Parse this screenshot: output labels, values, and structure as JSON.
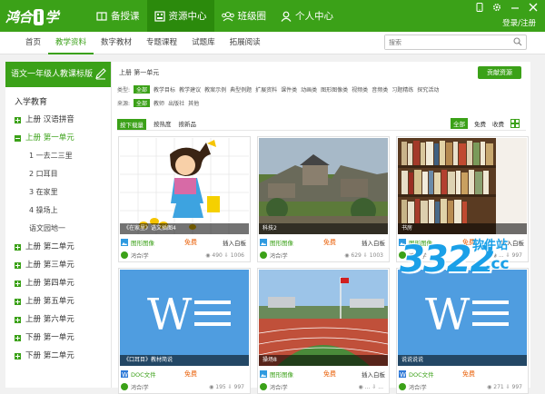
{
  "app": {
    "logo_text_1": "鸿合",
    "logo_text_i": "i",
    "logo_text_2": "学",
    "nav": [
      {
        "label": "备授课",
        "active": false
      },
      {
        "label": "资源中心",
        "active": true
      },
      {
        "label": "班级圈",
        "active": false
      },
      {
        "label": "个人中心",
        "active": false
      }
    ],
    "login_label": "登录/注册"
  },
  "subnav": {
    "tabs": [
      "首页",
      "教学资料",
      "数字教材",
      "专题课程",
      "试题库",
      "拓展阅读"
    ],
    "active_index": 1,
    "search_placeholder": "搜索"
  },
  "sidebar": {
    "title": "语文一年级人教课标版",
    "section": "入学教育",
    "items_before": [
      {
        "label": "上册 汉语拼音",
        "open": false
      }
    ],
    "open_item": {
      "label": "上册 第一单元"
    },
    "sub_items": [
      "1 一去二三里",
      "2 口耳目",
      "3 在家里",
      "4 操场上",
      "语文园地一"
    ],
    "items_after": [
      {
        "label": "上册 第二单元"
      },
      {
        "label": "上册 第三单元"
      },
      {
        "label": "上册 第四单元"
      },
      {
        "label": "上册 第五单元"
      },
      {
        "label": "上册 第六单元"
      },
      {
        "label": "下册 第一单元"
      },
      {
        "label": "下册 第二单元"
      }
    ]
  },
  "panel": {
    "breadcrumb": "上册 第一单元",
    "contribute_label": "贡献资源",
    "filter_type": {
      "label": "类型:",
      "options": [
        "全部",
        "教学目标",
        "教学建议",
        "教案示例",
        "典型例题",
        "扩展资料",
        "课件类",
        "动画类",
        "图形图像类",
        "视频类",
        "音频类",
        "习题精练",
        "探究活动"
      ],
      "active_index": 0
    },
    "filter_source": {
      "label": "来源:",
      "options": [
        "全部",
        "教师",
        "出版社",
        "其他"
      ],
      "active_index": 0
    },
    "sort": {
      "options": [
        "按下载量",
        "按热度",
        "按新品"
      ],
      "active_index": 0
    },
    "price": {
      "options": [
        "全部",
        "免费",
        "收费"
      ],
      "active_index": 0
    }
  },
  "cards": [
    {
      "caption": "《在家里》语文插图4",
      "type": "图形图像",
      "price": "免费",
      "action": "插入白板",
      "author": "鸿合i学",
      "views": "490",
      "downloads": "1006"
    },
    {
      "caption": "科技2",
      "type": "图形图像",
      "price": "免费",
      "action": "插入白板",
      "author": "鸿合i学",
      "views": "629",
      "downloads": "1003"
    },
    {
      "caption": "书房",
      "type": "图形图像",
      "price": "免费",
      "action": "插入白板",
      "author": "鸿合i学",
      "views": "...",
      "downloads": "997"
    },
    {
      "caption": "《口耳目》教材简说",
      "type": "DOC文件",
      "price": "免费",
      "action": "",
      "author": "鸿合i学",
      "views": "195",
      "downloads": "997"
    },
    {
      "caption": "操场8",
      "type": "图形图像",
      "price": "免费",
      "action": "插入白板",
      "author": "鸿合i学",
      "views": "...",
      "downloads": "..."
    },
    {
      "caption": "说说说说",
      "type": "DOC文件",
      "price": "免费",
      "action": "",
      "author": "鸿合i学",
      "views": "271",
      "downloads": "997"
    }
  ],
  "watermark": {
    "num": "3322",
    "cc": ".cc",
    "rj": "软件站"
  },
  "colors": {
    "accent": "#3ba118",
    "free": "#e95b00",
    "doc_blue": "#4f9de0"
  }
}
